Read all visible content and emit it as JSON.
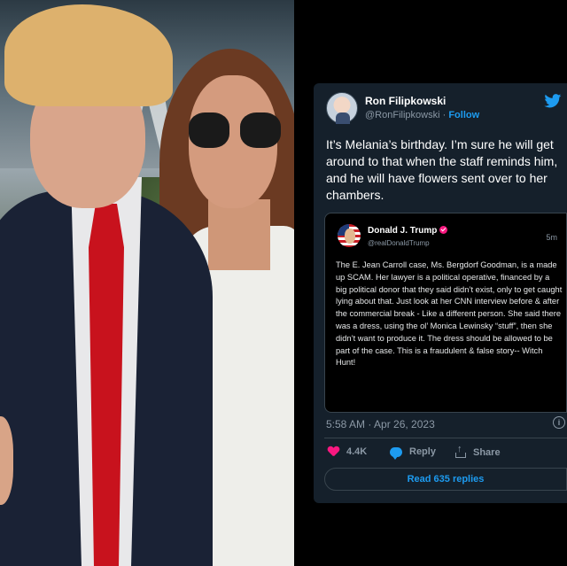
{
  "tweet": {
    "author_name": "Ron Filipkowski",
    "author_handle": "@RonFilipkowski",
    "follow_label": "Follow",
    "text": "It’s Melania’s birthday. I’m sure he will get around to that when the staff reminds him, and he will have flowers sent over to her chambers.",
    "timestamp": "5:58 AM · Apr 26, 2023",
    "likes": "4.4K",
    "reply_label": "Reply",
    "share_label": "Share",
    "read_replies_label": "Read 635 replies"
  },
  "quoted": {
    "author_name": "Donald J. Trump",
    "author_handle": "@realDonaldTrump",
    "time": "5m",
    "text": "The E. Jean Carroll case, Ms. Bergdorf Goodman, is a made up SCAM. Her lawyer is a political operative, financed by a big political donor that they said didn’t exist, only to get caught lying about that. Just look at her CNN interview before & after the commercial break - Like a different person. She said there was a dress, using the ol’ Monica Lewinsky “stuff”, then she didn’t want to produce it. The dress should be allowed to be part of the case. This is a fraudulent & false story-- Witch Hunt!"
  },
  "icons": {
    "brand": "twitter-bird-icon",
    "like": "heart-icon",
    "reply": "speech-bubble-icon",
    "share": "share-icon",
    "info": "info-icon",
    "verified": "verified-badge-icon"
  },
  "colors": {
    "card_bg": "#15202b",
    "accent": "#1d9bf0",
    "like": "#f91880"
  }
}
